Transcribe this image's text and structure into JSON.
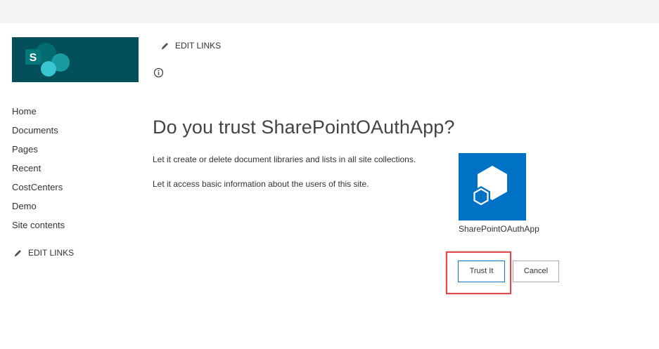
{
  "colors": {
    "topbar": "#f3f3f3",
    "logo_bg": "#03505a",
    "app_icon_bg": "#0072c6",
    "highlight": "#e04a4a",
    "button_focus_border": "#0f77c6"
  },
  "logo": {
    "letter": "S",
    "icon": "sharepoint-logo"
  },
  "sidebar": {
    "items": [
      {
        "label": "Home"
      },
      {
        "label": "Documents"
      },
      {
        "label": "Pages"
      },
      {
        "label": "Recent"
      },
      {
        "label": "CostCenters"
      },
      {
        "label": "Demo"
      },
      {
        "label": "Site contents"
      }
    ],
    "edit_links": "EDIT LINKS"
  },
  "header": {
    "edit_links": "EDIT LINKS",
    "info_icon": "info-icon"
  },
  "dialog": {
    "title": "Do you trust SharePointOAuthApp?",
    "permissions": [
      "Let it create or delete document libraries and lists in all site collections.",
      "Let it access basic information about the users of this site."
    ],
    "app_name": "SharePointOAuthApp",
    "app_icon": "app-cube-icon",
    "trust_label": "Trust It",
    "cancel_label": "Cancel"
  }
}
